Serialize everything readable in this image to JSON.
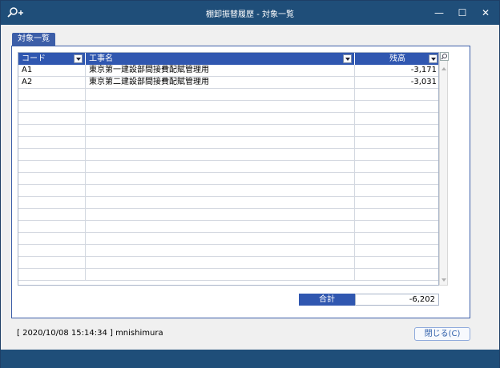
{
  "window": {
    "title": "棚卸振替履歴 - 対象一覧",
    "controls": {
      "minimize": "—",
      "maximize": "☐",
      "close": "✕"
    }
  },
  "tab": {
    "label": "対象一覧"
  },
  "grid": {
    "columns": [
      "コード",
      "工事名",
      "残高"
    ],
    "rows": [
      {
        "code": "A1",
        "name": "東京第一建設部間接費配賦管理用",
        "balance": "-3,171"
      },
      {
        "code": "A2",
        "name": "東京第二建設部間接費配賦管理用",
        "balance": "-3,031"
      }
    ]
  },
  "total": {
    "label": "合計",
    "value": "-6,202"
  },
  "status": {
    "text": "[ 2020/10/08 15:14:34 ] mnishimura"
  },
  "buttons": {
    "close": "閉じる(C)"
  },
  "icons": {
    "app": "search-plus-icon",
    "grid_search": "magnifier-icon"
  },
  "colors": {
    "titlebar": "#1f4e79",
    "header": "#3057b0",
    "tab": "#3c5ea8"
  }
}
